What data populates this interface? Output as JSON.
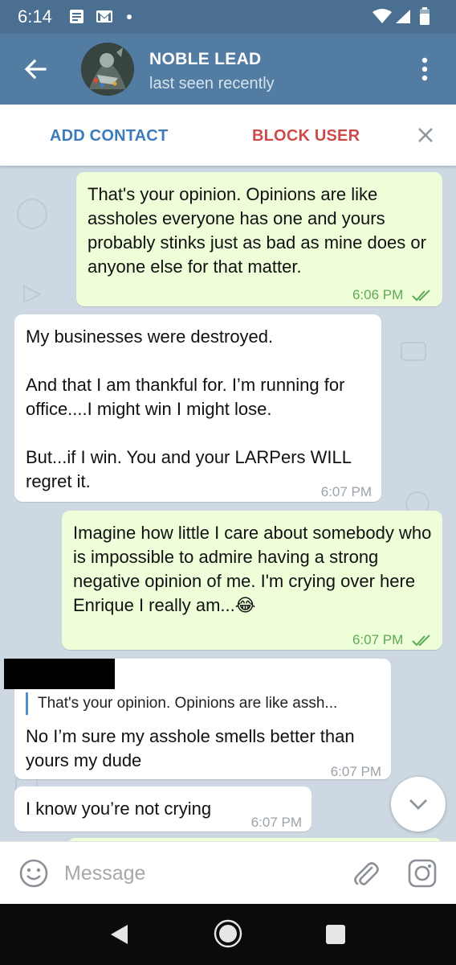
{
  "status_bar": {
    "time": "6:14",
    "icons": [
      "notes-icon",
      "gmail-icon",
      "notification-dot",
      "wifi-icon",
      "signal-icon",
      "battery-icon"
    ]
  },
  "header": {
    "back_icon": "arrow-left-icon",
    "name": "NOBLE LEAD",
    "status": "last seen recently",
    "menu_icon": "more-vertical-icon"
  },
  "action_bar": {
    "add_contact": "ADD CONTACT",
    "block_user": "BLOCK USER",
    "close_icon": "close-icon"
  },
  "messages": [
    {
      "direction": "out",
      "text": "That's your opinion. Opinions are like assholes everyone has one and yours probably stinks just as bad as mine does or anyone else for that matter.",
      "time": "6:06 PM",
      "read": true
    },
    {
      "direction": "in",
      "text": "My businesses were destroyed.\n\nAnd that I am thankful for. I’m running for office....I might win I might lose.\n\nBut...if I win. You and your LARPers WILL regret it.",
      "time": "6:07 PM"
    },
    {
      "direction": "out",
      "text": "Imagine how little I care about somebody who is impossible to admire having a strong negative opinion of me. I'm crying over here Enrique I really am...😂",
      "time": "6:07 PM",
      "read": true
    },
    {
      "direction": "in",
      "reply_quote": "That's your opinion. Opinions are like assh...",
      "text": "No I’m sure my asshole smells better than yours my dude",
      "time": "6:07 PM"
    },
    {
      "direction": "in",
      "text": "I know you’re not crying",
      "time": "6:07 PM"
    }
  ],
  "scroll_down_icon": "chevron-down-icon",
  "composer": {
    "emoji_icon": "emoji-icon",
    "placeholder": "Message",
    "value": "",
    "attach_icon": "paperclip-icon",
    "camera_icon": "camera-icon"
  },
  "nav": {
    "icons": [
      "nav-back-icon",
      "nav-home-icon",
      "nav-recents-icon"
    ]
  },
  "colors": {
    "header": "#527ca1",
    "status_bar": "#4a6f91",
    "outgoing_bubble": "#eefed9",
    "incoming_bubble": "#ffffff",
    "add_contact": "#3d7bbf",
    "block_user": "#cf4b4b",
    "outgoing_meta": "#5fa954"
  }
}
